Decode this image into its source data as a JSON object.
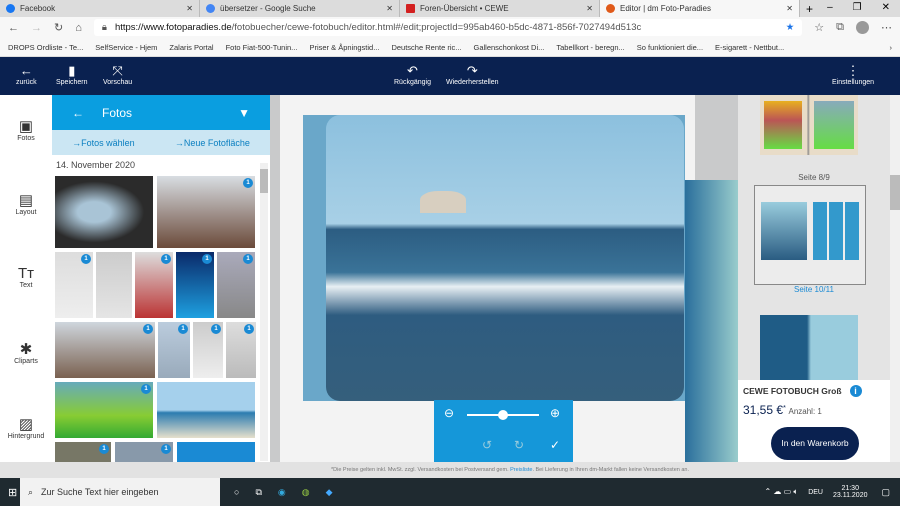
{
  "browser": {
    "tabs": [
      {
        "label": "Facebook",
        "color": "#1877f2"
      },
      {
        "label": "übersetzer - Google Suche",
        "color": "#4285f4"
      },
      {
        "label": "Foren-Übersicht • CEWE",
        "color": "#d32020"
      },
      {
        "label": "Editor | dm Foto-Paradies",
        "color": "#e05a1a"
      }
    ],
    "url_host": "https://www.fotoparadies.de",
    "url_path": "/fotobuecher/cewe-fotobuch/editor.html#/edit;projectId=995ab460-b5dc-4871-856f-7027494d513c",
    "bookmarks": [
      "DROPS Ordliste - Te...",
      "SelfService - Hjem",
      "Zalaris Portal",
      "Foto Fiat-500-Tunin...",
      "Priser & Åpningstid...",
      "Deutsche Rente ric...",
      "Gallenschonkost Di...",
      "Tabellkort - beregn...",
      "So funktioniert die...",
      "E-sigarett - Nettbut..."
    ]
  },
  "toolbar": {
    "back": "zurück",
    "save": "Speichern",
    "preview": "Vorschau",
    "undo": "Rückgängig",
    "redo": "Wiederherstellen",
    "settings": "Einstellungen"
  },
  "rail": [
    "Fotos",
    "Layout",
    "Text",
    "Cliparts",
    "Hintergrund"
  ],
  "panel": {
    "title": "Fotos",
    "choose": "→Fotos wählen",
    "new_area": "→Neue Fotofläche",
    "date": "14. November 2020",
    "badge": "1"
  },
  "pages": {
    "page_a": "Seite 8/9",
    "page_b": "Seite 10/11"
  },
  "product": {
    "name": "CEWE FOTOBUCH Groß",
    "price": "31,55 €",
    "price_mark": "*",
    "quantity": "Anzahl: 1",
    "cart": "In den Warenkorb"
  },
  "footer": {
    "text": "*Die Preise gelten inkl. MwSt. zzgl. Versandkosten bei Postversand gem.",
    "link": "Preisliste",
    "text2": ". Bei Lieferung in Ihren dm-Markt fallen keine Versandkosten an."
  },
  "zoom": {
    "level": 0.5
  },
  "taskbar": {
    "search": "Zur Suche Text hier eingeben",
    "lang": "DEU",
    "time": "21:30",
    "date": "23.11.2020"
  }
}
